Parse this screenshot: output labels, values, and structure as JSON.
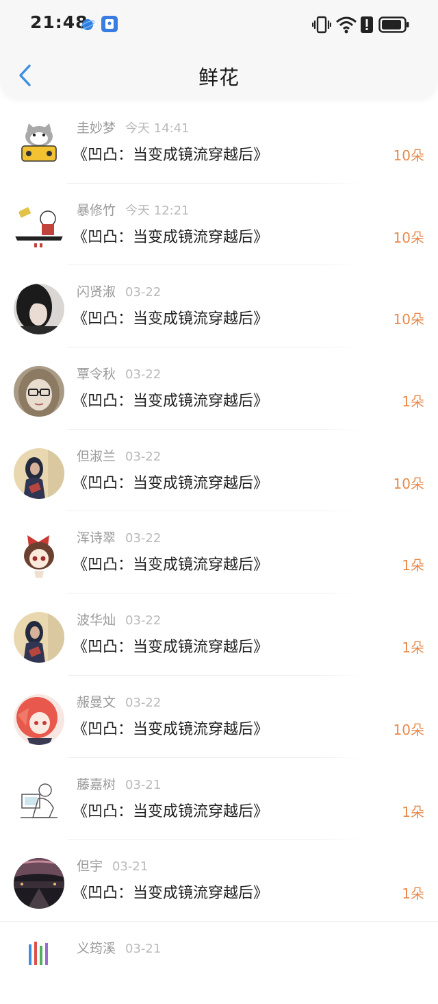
{
  "status_bar": {
    "time": "21:48",
    "icons": [
      "browser-icon",
      "shield-app-icon",
      "vibrate-icon",
      "wifi-icon",
      "alert-icon",
      "battery-icon"
    ]
  },
  "nav": {
    "back_icon": "chevron-left-icon",
    "title": "鲜花"
  },
  "colors": {
    "accent_blue": "#3d8fe0",
    "count_orange": "#e8894a",
    "name_gray": "#999999"
  },
  "items": [
    {
      "name": "圭妙梦",
      "time": "今天 14:41",
      "title": "《凹凸：当变成镜流穿越后》",
      "count": "10朵",
      "avatar": "cartoon-cat-avatar"
    },
    {
      "name": "暴修竹",
      "time": "今天 12:21",
      "title": "《凹凸：当变成镜流穿越后》",
      "count": "10朵",
      "avatar": "meme-avatar"
    },
    {
      "name": "闪贤淑",
      "time": "03-22",
      "title": "《凹凸：当变成镜流穿越后》",
      "count": "10朵",
      "avatar": "dark-hair-avatar"
    },
    {
      "name": "覃令秋",
      "time": "03-22",
      "title": "《凹凸：当变成镜流穿越后》",
      "count": "1朵",
      "avatar": "doll-glasses-avatar"
    },
    {
      "name": "但淑兰",
      "time": "03-22",
      "title": "《凹凸：当变成镜流穿越后》",
      "count": "10朵",
      "avatar": "girl-photo-avatar"
    },
    {
      "name": "浑诗翠",
      "time": "03-22",
      "title": "《凹凸：当变成镜流穿越后》",
      "count": "1朵",
      "avatar": "anime-red-bow-avatar"
    },
    {
      "name": "波华灿",
      "time": "03-22",
      "title": "《凹凸：当变成镜流穿越后》",
      "count": "1朵",
      "avatar": "girl-photo-avatar"
    },
    {
      "name": "赧曼文",
      "time": "03-22",
      "title": "《凹凸：当变成镜流穿越后》",
      "count": "10朵",
      "avatar": "anime-pink-hair-avatar"
    },
    {
      "name": "藤嘉树",
      "time": "03-21",
      "title": "《凹凸：当变成镜流穿越后》",
      "count": "1朵",
      "avatar": "sketch-avatar"
    },
    {
      "name": "但宇",
      "time": "03-21",
      "title": "《凹凸：当变成镜流穿越后》",
      "count": "1朵",
      "avatar": "night-city-avatar"
    },
    {
      "name": "义筠溪",
      "time": "03-21",
      "title": "",
      "count": "",
      "avatar": "pencils-avatar"
    }
  ]
}
